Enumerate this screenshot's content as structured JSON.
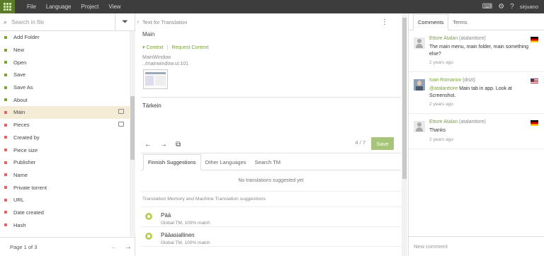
{
  "topbar": {
    "menu": [
      "File",
      "Language",
      "Project",
      "View"
    ],
    "user": "sirjuano",
    "icons": [
      "keyboard-icon",
      "gear-icon",
      "help-icon"
    ]
  },
  "sidebar": {
    "search_placeholder": "Search in file",
    "items": [
      {
        "label": "Add Folder",
        "status": "translated"
      },
      {
        "label": "New",
        "status": "translated"
      },
      {
        "label": "Open",
        "status": "translated"
      },
      {
        "label": "Save",
        "status": "translated"
      },
      {
        "label": "Save As",
        "status": "translated"
      },
      {
        "label": "About",
        "status": "translated"
      },
      {
        "label": "Main",
        "status": "untranslated",
        "selected": true,
        "has_comment": true
      },
      {
        "label": "Pieces",
        "status": "untranslated",
        "has_comment": true
      },
      {
        "label": "Created by",
        "status": "untranslated"
      },
      {
        "label": "Piece size",
        "status": "untranslated"
      },
      {
        "label": "Publisher",
        "status": "untranslated"
      },
      {
        "label": "Name",
        "status": "untranslated"
      },
      {
        "label": "Private torrent",
        "status": "untranslated"
      },
      {
        "label": "URL",
        "status": "untranslated"
      },
      {
        "label": "Date created",
        "status": "untranslated"
      },
      {
        "label": "Hash",
        "status": "untranslated"
      }
    ],
    "pager": "Page 1 of 3"
  },
  "editor": {
    "source_label": "Text for Translation",
    "source_text": "Main",
    "context_label": "Context",
    "request_context": "Request Context",
    "context_window": "MainWindow",
    "context_file": "../mainwindow.ui:101",
    "translation_text": "Tärkein",
    "counter": "4 / 7",
    "save_label": "Save",
    "tabs": [
      "Finnish Suggestions",
      "Other Languages",
      "Search TM"
    ],
    "no_suggestions": "No translations suggested yet",
    "tm_heading": "Translation Memory and Machine Translation suggestions",
    "suggestions": [
      {
        "text": "Pää",
        "match": "Global TM, 100% match"
      },
      {
        "text": "Pääasiallinen",
        "match": "Global TM, 100% match"
      }
    ]
  },
  "comments_panel": {
    "tabs": [
      "Comments",
      "Terms"
    ],
    "comments": [
      {
        "author": "Ettore Atalan",
        "username": "(atalanttore)",
        "body": "The main menu, main folder, main something else?",
        "date": "2 years ago",
        "flag": "de"
      },
      {
        "author": "Ivan Romanov",
        "username": "(drizt)",
        "mention": "@atalanttore",
        "body": " Main tab in app. Look at Screenshot.",
        "date": "2 years ago",
        "flag": "us"
      },
      {
        "author": "Ettore Atalan",
        "username": "(atalanttore)",
        "body": "Thanks",
        "date": "2 years ago",
        "flag": "de"
      }
    ],
    "new_comment_placeholder": "New comment"
  }
}
